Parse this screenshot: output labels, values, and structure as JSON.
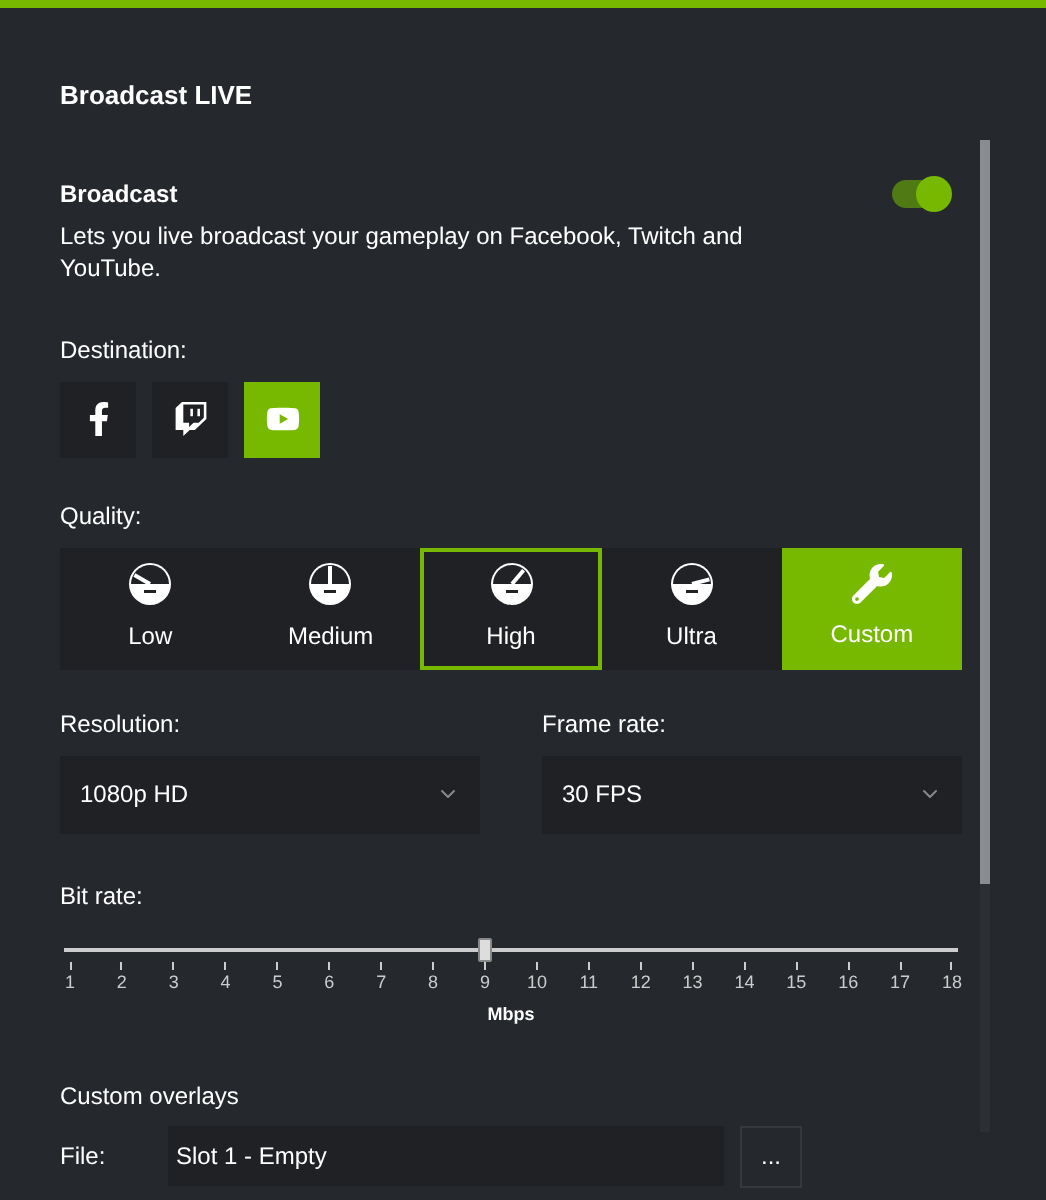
{
  "title": "Broadcast LIVE",
  "broadcast": {
    "label": "Broadcast",
    "description": "Lets you live broadcast your gameplay on Facebook, Twitch and YouTube.",
    "on": true
  },
  "destination": {
    "label": "Destination:",
    "items": [
      {
        "kind": "facebook",
        "selected": false
      },
      {
        "kind": "twitch",
        "selected": false
      },
      {
        "kind": "youtube",
        "selected": true
      }
    ]
  },
  "quality": {
    "label": "Quality:",
    "options": [
      {
        "kind": "low",
        "label": "Low",
        "selected": false,
        "hovered": false
      },
      {
        "kind": "medium",
        "label": "Medium",
        "selected": false,
        "hovered": false
      },
      {
        "kind": "high",
        "label": "High",
        "selected": false,
        "hovered": true
      },
      {
        "kind": "ultra",
        "label": "Ultra",
        "selected": false,
        "hovered": false
      },
      {
        "kind": "custom",
        "label": "Custom",
        "selected": true,
        "hovered": false
      }
    ]
  },
  "resolution": {
    "label": "Resolution:",
    "value": "1080p HD"
  },
  "frame_rate": {
    "label": "Frame rate:",
    "value": "30 FPS"
  },
  "bit_rate": {
    "label": "Bit rate:",
    "level": 0.47,
    "ticks": [
      "1",
      "2",
      "3",
      "4",
      "5",
      "6",
      "7",
      "8",
      "9",
      "10",
      "11",
      "12",
      "13",
      "14",
      "15",
      "16",
      "17",
      "18"
    ],
    "unit": "Mbps"
  },
  "overlays": {
    "label": "Custom overlays",
    "file_label": "File:",
    "file_value": "Slot 1 - Empty",
    "browse": "..."
  }
}
